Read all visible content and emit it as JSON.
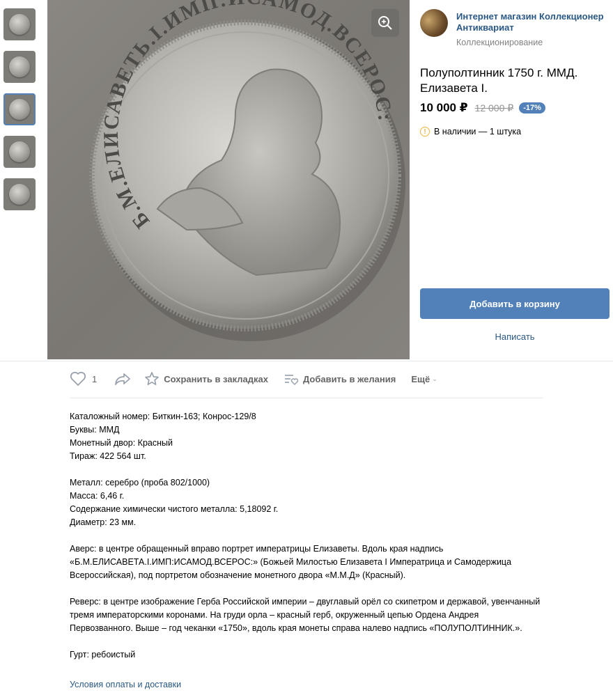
{
  "store": {
    "name": "Интернет магазин Коллекционер Антиквариат",
    "category": "Коллекционирование"
  },
  "product": {
    "title": "Полуполтинник 1750 г. ММД. Елизавета I.",
    "price": "10 000 ₽",
    "old_price": "12 000 ₽",
    "discount": "-17%",
    "stock": "В наличии — 1 штука"
  },
  "buttons": {
    "add_to_cart": "Добавить в корзину",
    "write": "Написать"
  },
  "actions": {
    "likes_count": "1",
    "save_bookmarks": "Сохранить в закладках",
    "add_wishlist": "Добавить в желания",
    "more": "Ещё"
  },
  "photo": {
    "coin_inscription": "Б.М.ЕЛИСАВЕТЬ.I.ИМП:ИСАМОД.ВСЕРОС:"
  },
  "description": {
    "lines_block1": [
      "Каталожный номер: Биткин-163; Конрос-129/8",
      "Буквы: ММД",
      "Монетный двор: Красный",
      "Тираж: 422 564 шт."
    ],
    "lines_block2": [
      "Металл: серебро (проба 802/1000)",
      "Масса: 6,46 г.",
      "Содержание химически чистого металла: 5,18092 г.",
      "Диаметр: 23 мм."
    ],
    "avers": "Аверс: в центре обращенный вправо портрет императрицы Елизаветы. Вдоль края надпись «Б.М.ЕЛИСАВЕТА.I.ИМП:ИСАМОД.ВСЕРОС:» (Божьей Милостью Елизавета I Императрица и Самодержица Всероссийская), под портретом обозначение монетного двора «М.М.Д» (Красный).",
    "revers": "Реверс: в центре изображение Герба Российской империи – двуглавый орёл со скипетром и державой, увенчанный тремя императорскими коронами. На груди орла – красный герб, окруженный цепью Ордена Андрея Первозванного. Выше – год чеканки «1750», вдоль края монеты справа налево надпись «ПОЛУПОЛТИННИК.».",
    "gurt": "Гурт: ребоистый"
  },
  "terms_link": "Условия оплаты и доставки",
  "colors": {
    "accent": "#5181b8",
    "link": "#2a5885",
    "warning": "#f0b43c"
  }
}
